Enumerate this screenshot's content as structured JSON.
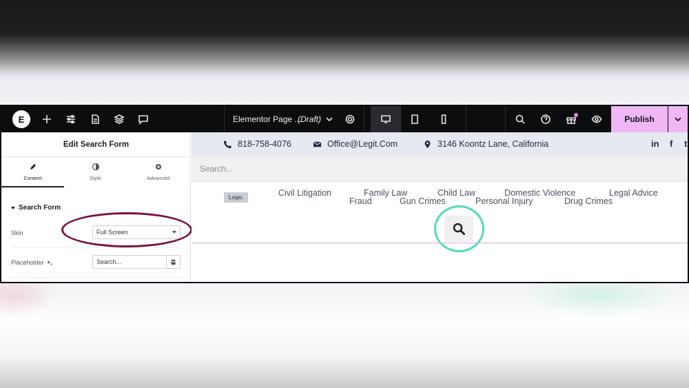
{
  "topbar": {
    "logo": "E",
    "page_title": "Elementor Page ...",
    "page_status": "(Draft)",
    "publish_label": "Publish",
    "icons": [
      "plus-icon",
      "sliders-icon",
      "page-icon",
      "layers-icon",
      "comment-icon",
      "chevron-down-icon",
      "gear-icon",
      "desktop-icon",
      "tablet-icon",
      "mobile-icon",
      "search-icon",
      "help-icon",
      "gift-icon",
      "eye-icon"
    ],
    "accent_color": "#f0b7f5"
  },
  "panel": {
    "title": "Edit Search Form",
    "tabs": [
      {
        "label": "Content",
        "icon": "pencil-icon",
        "active": true
      },
      {
        "label": "Style",
        "icon": "half-circle-icon",
        "active": false
      },
      {
        "label": "Advanced",
        "icon": "gear-icon",
        "active": false
      }
    ],
    "section_title": "Search Form",
    "skin_label": "Skin",
    "skin_value": "Full Screen",
    "placeholder_label": "Placeholder",
    "placeholder_value": "Search..."
  },
  "preview": {
    "phone": "818-758-4076",
    "email": "Office@Legit.Com",
    "address": "3146 Koontz Lane, California",
    "social": [
      "in",
      "f",
      "t"
    ],
    "search_placeholder": "Search...",
    "logo": "Logo.",
    "nav": [
      "Civil Litigation",
      "Family Law",
      "Child Law",
      "Domestic Violence",
      "Legal Advice",
      "Fraud",
      "Gun Crimes",
      "Personal Injury",
      "Drug Crimes"
    ]
  },
  "annotations": {
    "ellipse_color": "#7a0d3d",
    "circle_color": "#4fdcb5"
  }
}
